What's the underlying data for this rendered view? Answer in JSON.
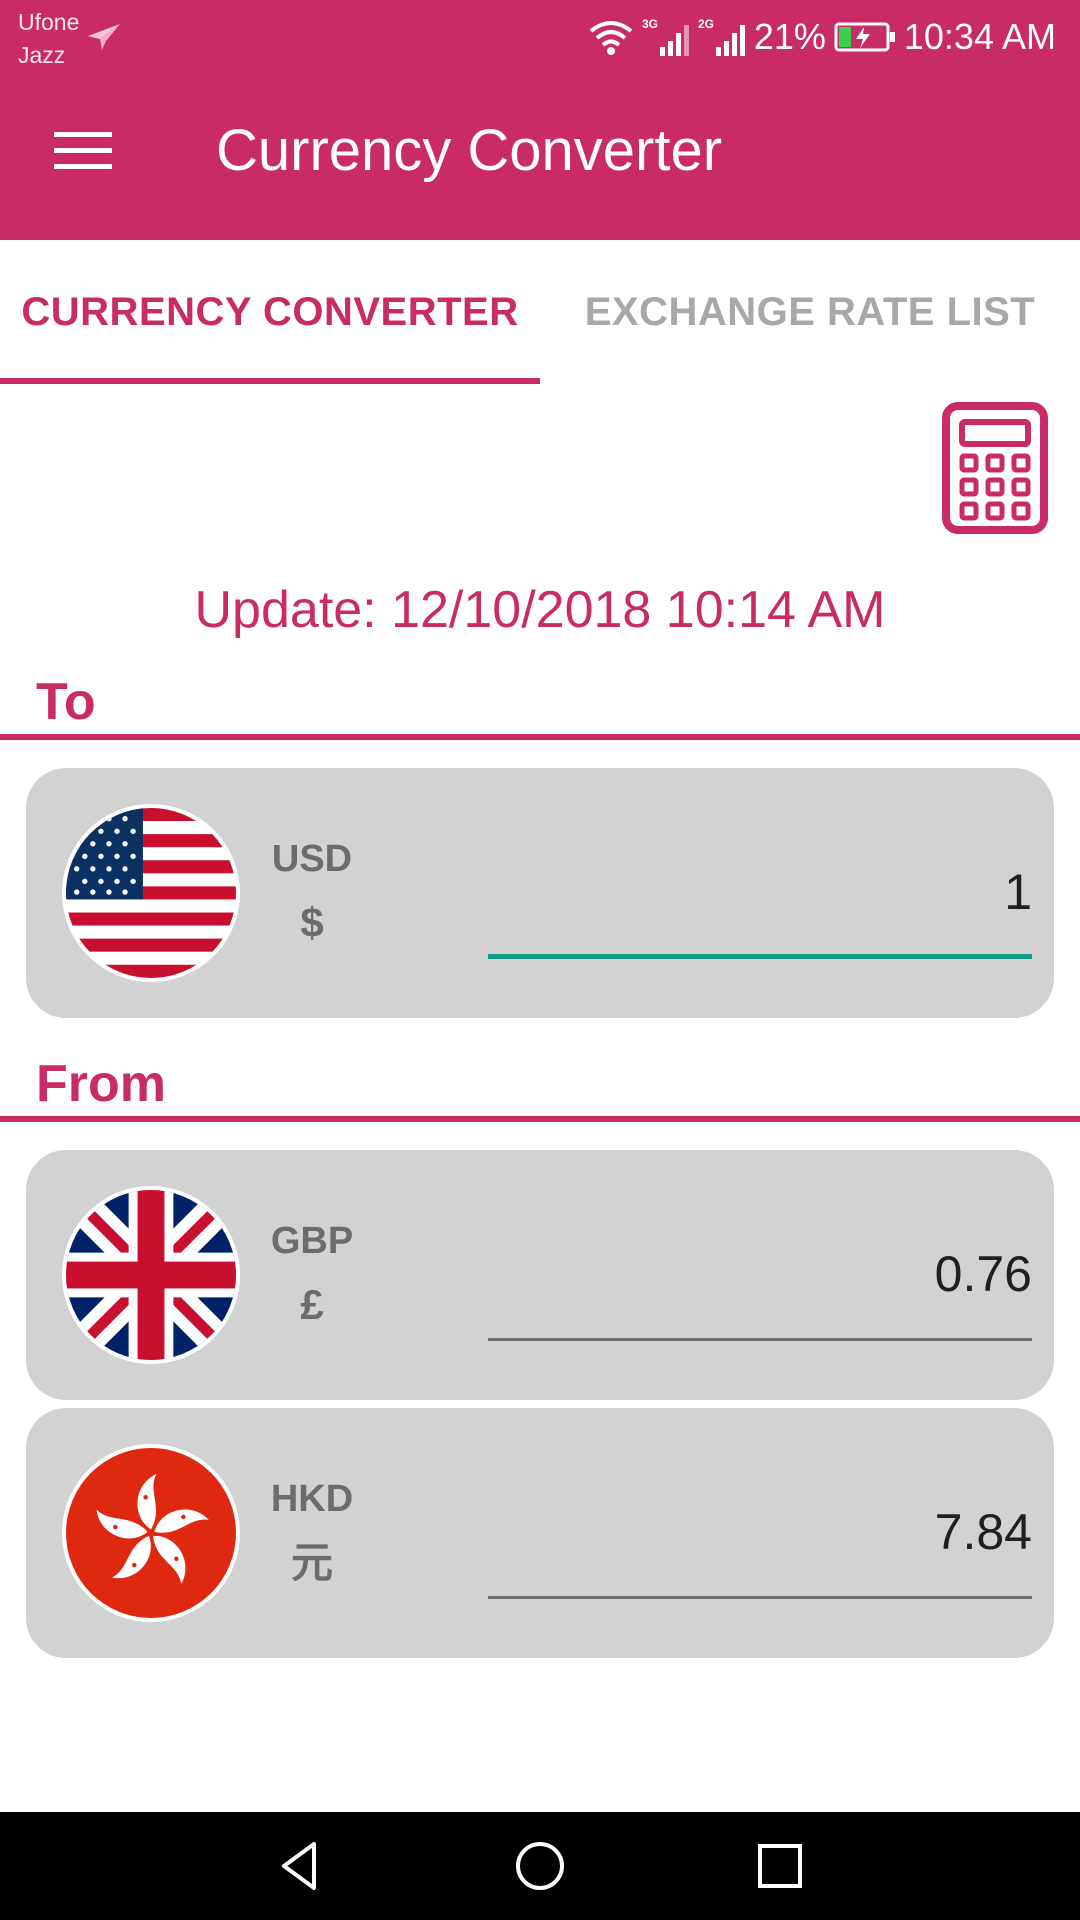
{
  "status_bar": {
    "carrier_line1": "Ufone",
    "carrier_line2": "Jazz",
    "network1": "3G",
    "network2": "2G",
    "battery_percent": "21%",
    "time": "10:34 AM"
  },
  "app_bar": {
    "title": "Currency Converter",
    "color": "#c82b66"
  },
  "tabs": [
    {
      "label": "CURRENCY CONVERTER",
      "selected": true
    },
    {
      "label": "EXCHANGE RATE LIST",
      "selected": false
    }
  ],
  "update": {
    "text": "Update: 12/10/2018 10:14 AM"
  },
  "sections": {
    "to_label": "To",
    "from_label": "From"
  },
  "to_currency": {
    "code": "USD",
    "symbol": "$",
    "value": "1",
    "flag": "us-flag-icon"
  },
  "from_currencies": [
    {
      "code": "GBP",
      "symbol": "£",
      "value": "0.76",
      "flag": "uk-flag-icon"
    },
    {
      "code": "HKD",
      "symbol": "元",
      "value": "7.84",
      "flag": "hk-flag-icon"
    }
  ],
  "icons": {
    "menu": "menu-icon",
    "calculator": "calculator-icon",
    "back": "back-icon",
    "home": "home-icon",
    "recents": "recents-icon"
  },
  "colors": {
    "accent": "#c82b66",
    "input_focus": "#14a08c",
    "card_bg": "#d2d2d2"
  }
}
